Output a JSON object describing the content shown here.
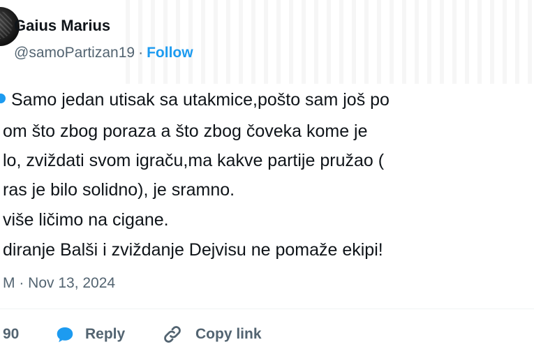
{
  "author": {
    "name": "Gaius Marius",
    "handle": "@samoPartizan19",
    "separator": "·",
    "follow_label": "Follow"
  },
  "tweet": {
    "lines": [
      "Samo jedan utisak sa utakmice,pošto sam još po",
      "om što zbog poraza a što zbog čoveka kome je",
      "lo, zviždati svom igraču,ma kakve partije pružao (",
      "ras je bilo solidno), je sramno.",
      "više ličimo na cigane.",
      "diranje Balši i zviždanje Dejvisu ne pomaže ekipi!"
    ],
    "timestamp": "M · Nov 13, 2024"
  },
  "actions": {
    "like_count": "90",
    "reply_label": "Reply",
    "copy_label": "Copy link"
  },
  "colors": {
    "accent": "#1d9bf0",
    "text": "#0f1419",
    "secondary": "#536471"
  },
  "icons": {
    "reply": "speech-bubble-icon",
    "copy": "link-icon"
  }
}
